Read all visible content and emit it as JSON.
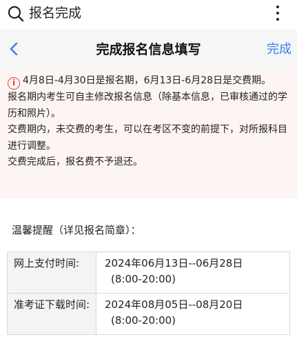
{
  "search": {
    "query": "报名完成"
  },
  "nav": {
    "title": "完成报名信息填写",
    "done_label": "完成"
  },
  "notice": {
    "lines": [
      "4月8日-4月30日是报名期，6月13日-6月28日是交费期。",
      "报名期内考生可自主修改报名信息（除基本信息，已审核通过的学历和照片）。",
      "交费期内，未交费的考生，可以在考区不变的前提下，对所报科目进行调整。",
      "交费完成后，报名费不予退还。"
    ]
  },
  "reminder": {
    "title": "温馨提醒（详见报名简章）：",
    "rows": [
      {
        "label": "网上支付时间:",
        "date": "2024年06月13日--06月28日",
        "time": "(8:00-20:00)"
      },
      {
        "label": "准考证下载时间:",
        "date": "2024年08月05日--08月20日",
        "time": "(8:00-20:00)"
      }
    ]
  },
  "colors": {
    "accent": "#3a82e8",
    "warning": "#e2474a",
    "notice_bg": "#fcf5f3",
    "nav_bg": "#f6f6f6"
  },
  "icons": [
    "search-icon",
    "more-vertical-icon",
    "chevron-left-icon",
    "info-icon"
  ]
}
